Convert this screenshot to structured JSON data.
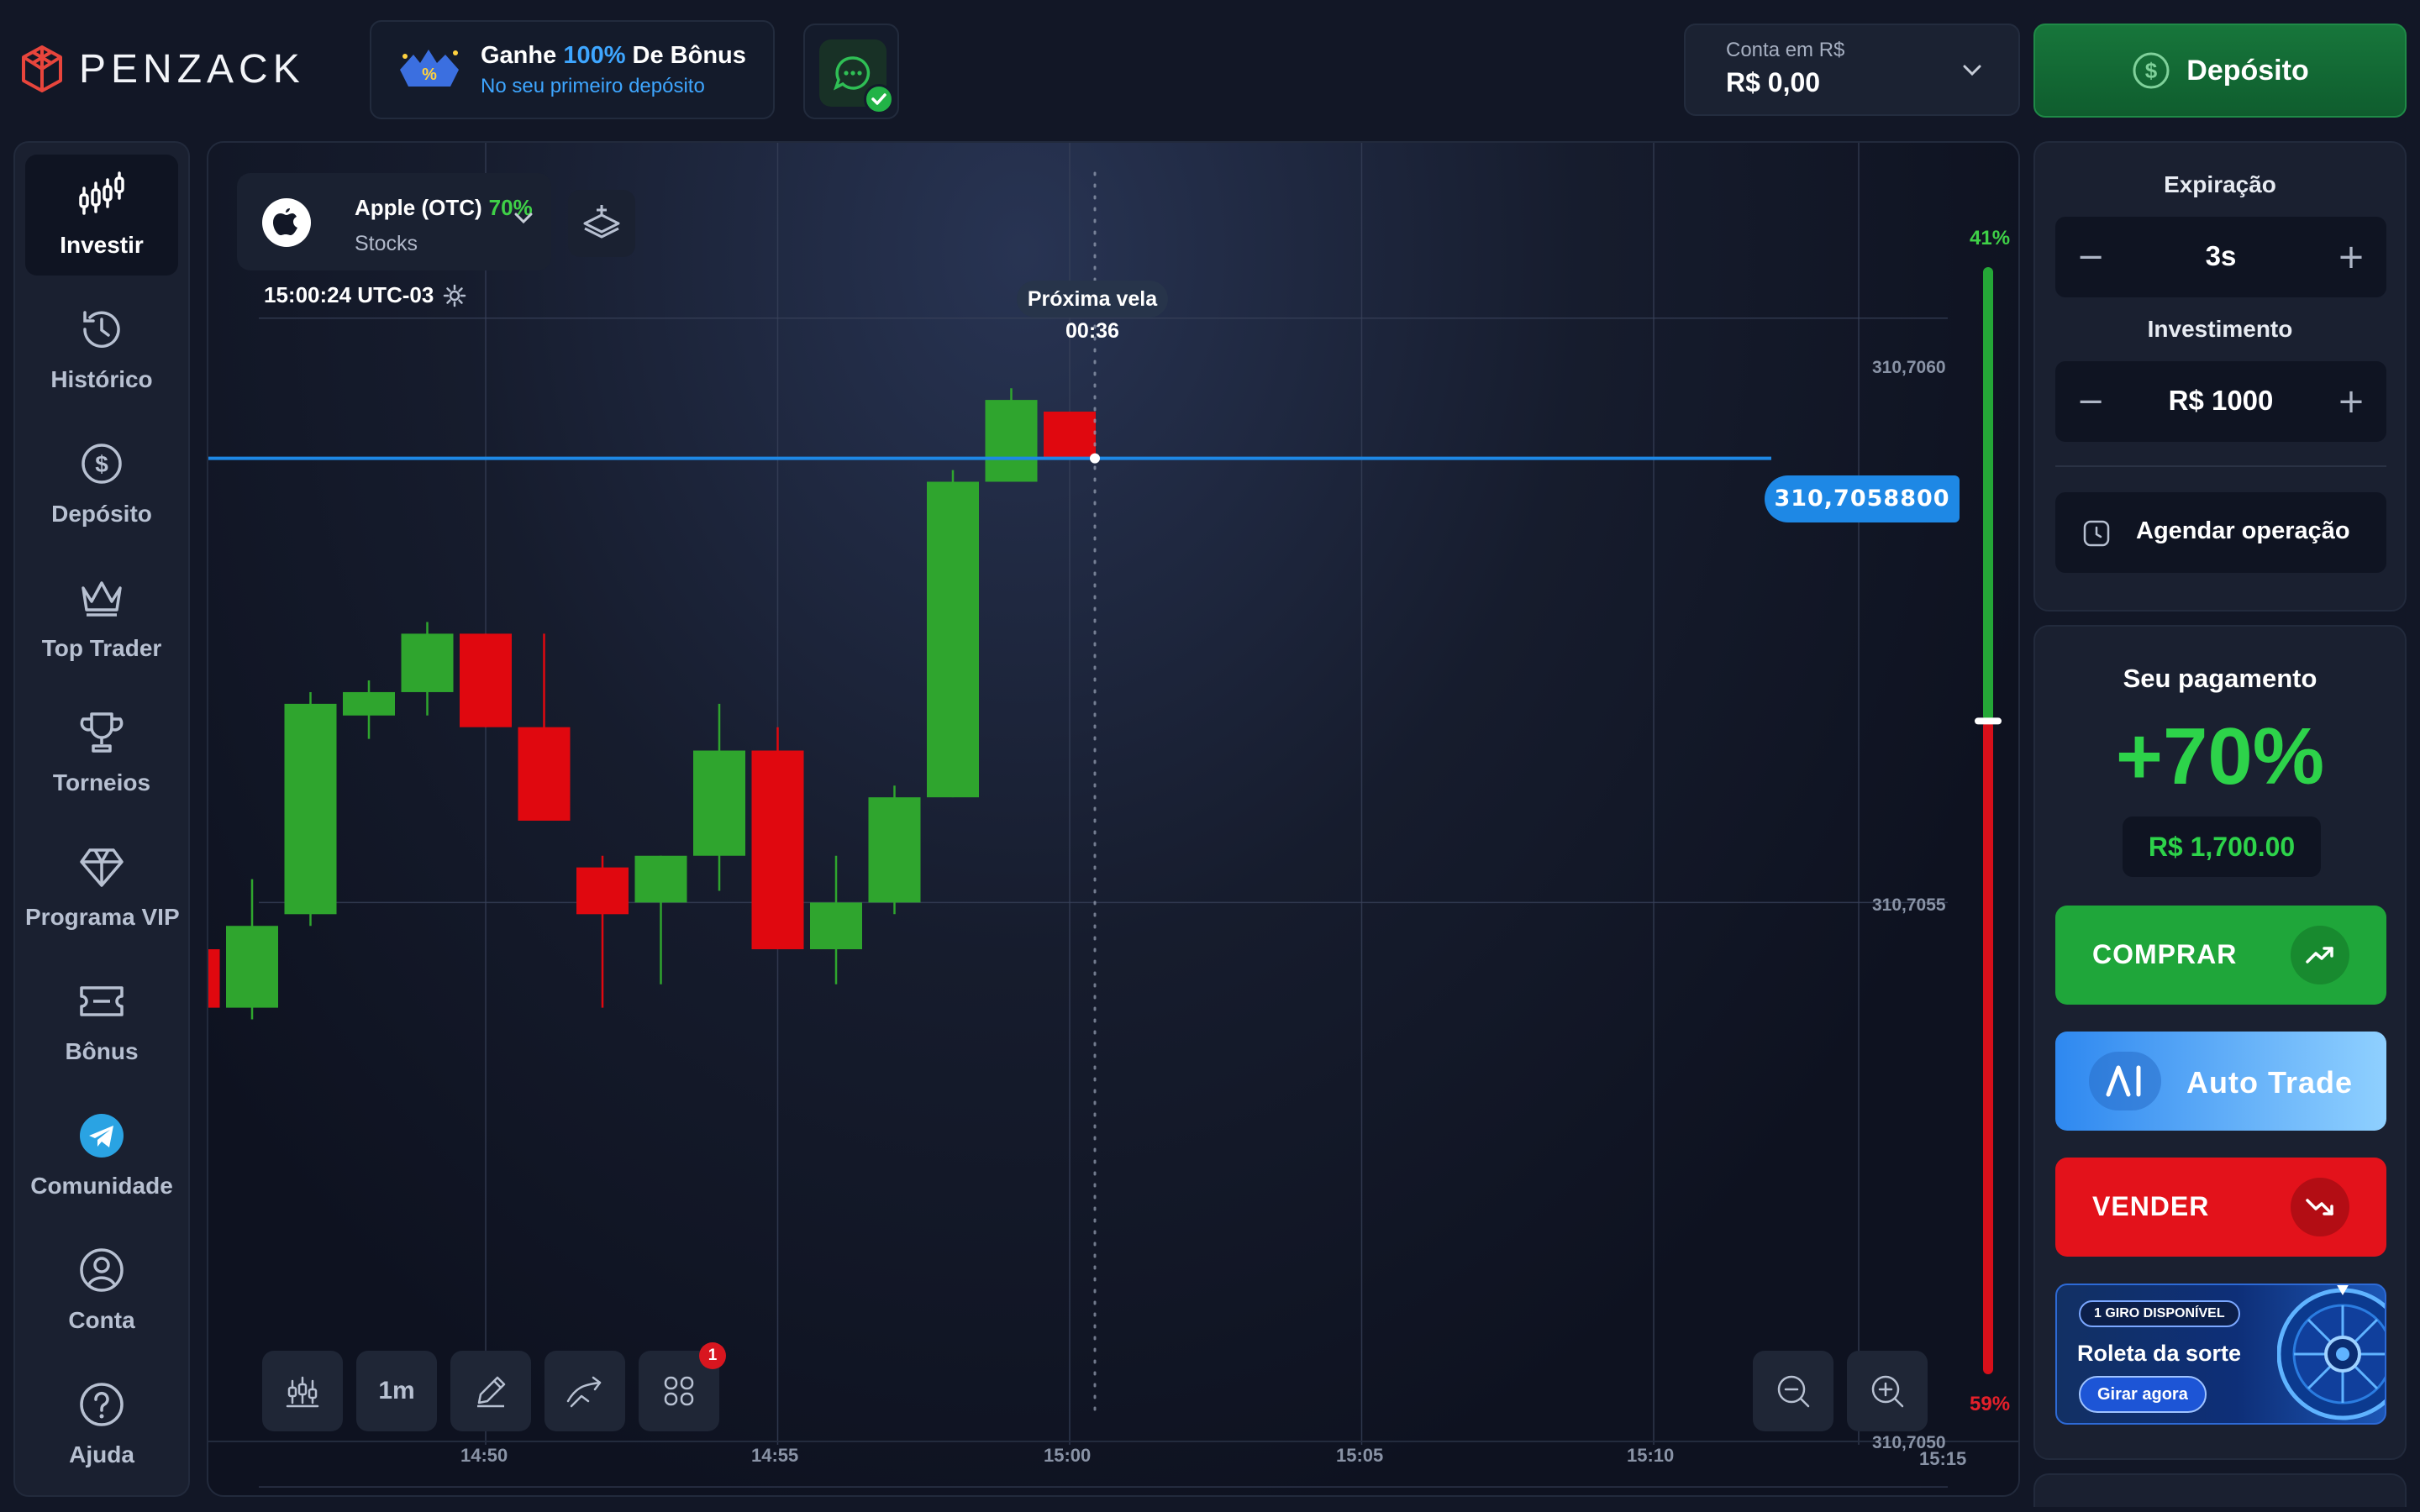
{
  "brand": {
    "name": "PENZACK",
    "logo_icon": "cube-logo-icon",
    "accent": "#e8453c"
  },
  "promo": {
    "title_prefix": "Ganhe ",
    "title_highlight": "100%",
    "title_suffix": " De Bônus",
    "subtitle": "No seu primeiro depósito",
    "icon": "bonus-badge-icon"
  },
  "chat": {
    "icon": "chat-bubble-icon",
    "status_icon": "check-icon"
  },
  "account": {
    "label": "Conta em R$",
    "balance": "R$ 0,00"
  },
  "deposit": {
    "label": "Depósito",
    "icon": "dollar-circle-icon",
    "color": "#17763b"
  },
  "sidebar": {
    "items": [
      {
        "label": "Investir",
        "icon": "candlestick-icon",
        "active": true
      },
      {
        "label": "Histórico",
        "icon": "history-icon"
      },
      {
        "label": "Depósito",
        "icon": "dollar-circle-icon"
      },
      {
        "label": "Top Trader",
        "icon": "crown-icon"
      },
      {
        "label": "Torneios",
        "icon": "trophy-icon"
      },
      {
        "label": "Programa VIP",
        "icon": "diamond-icon"
      },
      {
        "label": "Bônus",
        "icon": "ticket-icon"
      },
      {
        "label": "Comunidade",
        "icon": "telegram-icon"
      },
      {
        "label": "Conta",
        "icon": "user-circle-icon"
      },
      {
        "label": "Ajuda",
        "icon": "help-circle-icon"
      }
    ]
  },
  "asset": {
    "name": "Apple (OTC)",
    "payout": "70%",
    "type": "Stocks",
    "icon": "apple-icon"
  },
  "clock": {
    "time": "15:00:24 UTC-03",
    "icon": "gear-icon"
  },
  "next_candle": {
    "label": "Próxima vela",
    "countdown": "00:36"
  },
  "current_price": "310,7058800",
  "sentiment": {
    "up": "41%",
    "down": "59%",
    "up_fraction": 0.41
  },
  "toolbar": {
    "timeframe": "1m",
    "indicator_badge": "1",
    "icons": [
      "chart-type-icon",
      "timeframe",
      "draw-pencil-icon",
      "trend-arrow-icon",
      "indicators-grid-icon"
    ],
    "zoom_icons": [
      "zoom-out-icon",
      "zoom-in-icon"
    ]
  },
  "colors": {
    "up": "#2fa52e",
    "down": "#e0080f",
    "price_line": "#1e88e5"
  },
  "chart_data": {
    "type": "candlestick",
    "x_ticks": [
      "14:50",
      "14:55",
      "15:00",
      "15:05",
      "15:10",
      "15:15"
    ],
    "y_ticks": [
      "310,7060",
      "310,7055",
      "310,7050"
    ],
    "y_tick_values": [
      310.706,
      310.7055,
      310.705
    ],
    "ylim": [
      310.70499,
      310.70615
    ],
    "grid": true,
    "current_price": 310.70588,
    "candles": [
      {
        "t": "14:45",
        "o": 310.70546,
        "h": 310.70549,
        "l": 310.70541,
        "c": 310.70541
      },
      {
        "t": "14:46",
        "o": 310.70541,
        "h": 310.70552,
        "l": 310.7054,
        "c": 310.70548
      },
      {
        "t": "14:47",
        "o": 310.70549,
        "h": 310.70568,
        "l": 310.70548,
        "c": 310.70567
      },
      {
        "t": "14:48",
        "o": 310.70566,
        "h": 310.70569,
        "l": 310.70564,
        "c": 310.70568
      },
      {
        "t": "14:49",
        "o": 310.70568,
        "h": 310.70574,
        "l": 310.70566,
        "c": 310.70573
      },
      {
        "t": "14:50",
        "o": 310.70573,
        "h": 310.70573,
        "l": 310.70565,
        "c": 310.70565
      },
      {
        "t": "14:51",
        "o": 310.70565,
        "h": 310.70573,
        "l": 310.70557,
        "c": 310.70557
      },
      {
        "t": "14:52",
        "o": 310.70553,
        "h": 310.70554,
        "l": 310.70541,
        "c": 310.70549
      },
      {
        "t": "14:53",
        "o": 310.7055,
        "h": 310.70554,
        "l": 310.70543,
        "c": 310.70554
      },
      {
        "t": "14:54",
        "o": 310.70554,
        "h": 310.70567,
        "l": 310.70551,
        "c": 310.70563
      },
      {
        "t": "14:55",
        "o": 310.70563,
        "h": 310.70565,
        "l": 310.70546,
        "c": 310.70546
      },
      {
        "t": "14:56",
        "o": 310.70546,
        "h": 310.70554,
        "l": 310.70543,
        "c": 310.7055
      },
      {
        "t": "14:57",
        "o": 310.7055,
        "h": 310.7056,
        "l": 310.70549,
        "c": 310.70559
      },
      {
        "t": "14:58",
        "o": 310.70559,
        "h": 310.70587,
        "l": 310.70559,
        "c": 310.70586
      },
      {
        "t": "14:59",
        "o": 310.70586,
        "h": 310.70594,
        "l": 310.70586,
        "c": 310.70593
      },
      {
        "t": "15:00",
        "o": 310.70592,
        "h": 310.70592,
        "l": 310.70588,
        "c": 310.70588
      }
    ]
  },
  "right_panel": {
    "expiration_label": "Expiração",
    "expiration_value": "3s",
    "investment_label": "Investimento",
    "investment_value": "R$ 1000",
    "minus": "−",
    "plus": "+",
    "schedule_label": "Agendar operação",
    "payout_label": "Seu pagamento",
    "payout_pct": "+70%",
    "payout_amount": "R$ 1,700.00",
    "buy_label": "COMPRAR",
    "auto_label": "Auto Trade",
    "sell_label": "VENDER",
    "roulette_chip": "1 GIRO DISPONÍVEL",
    "roulette_title": "Roleta da sorte",
    "roulette_cta": "Girar agora"
  }
}
